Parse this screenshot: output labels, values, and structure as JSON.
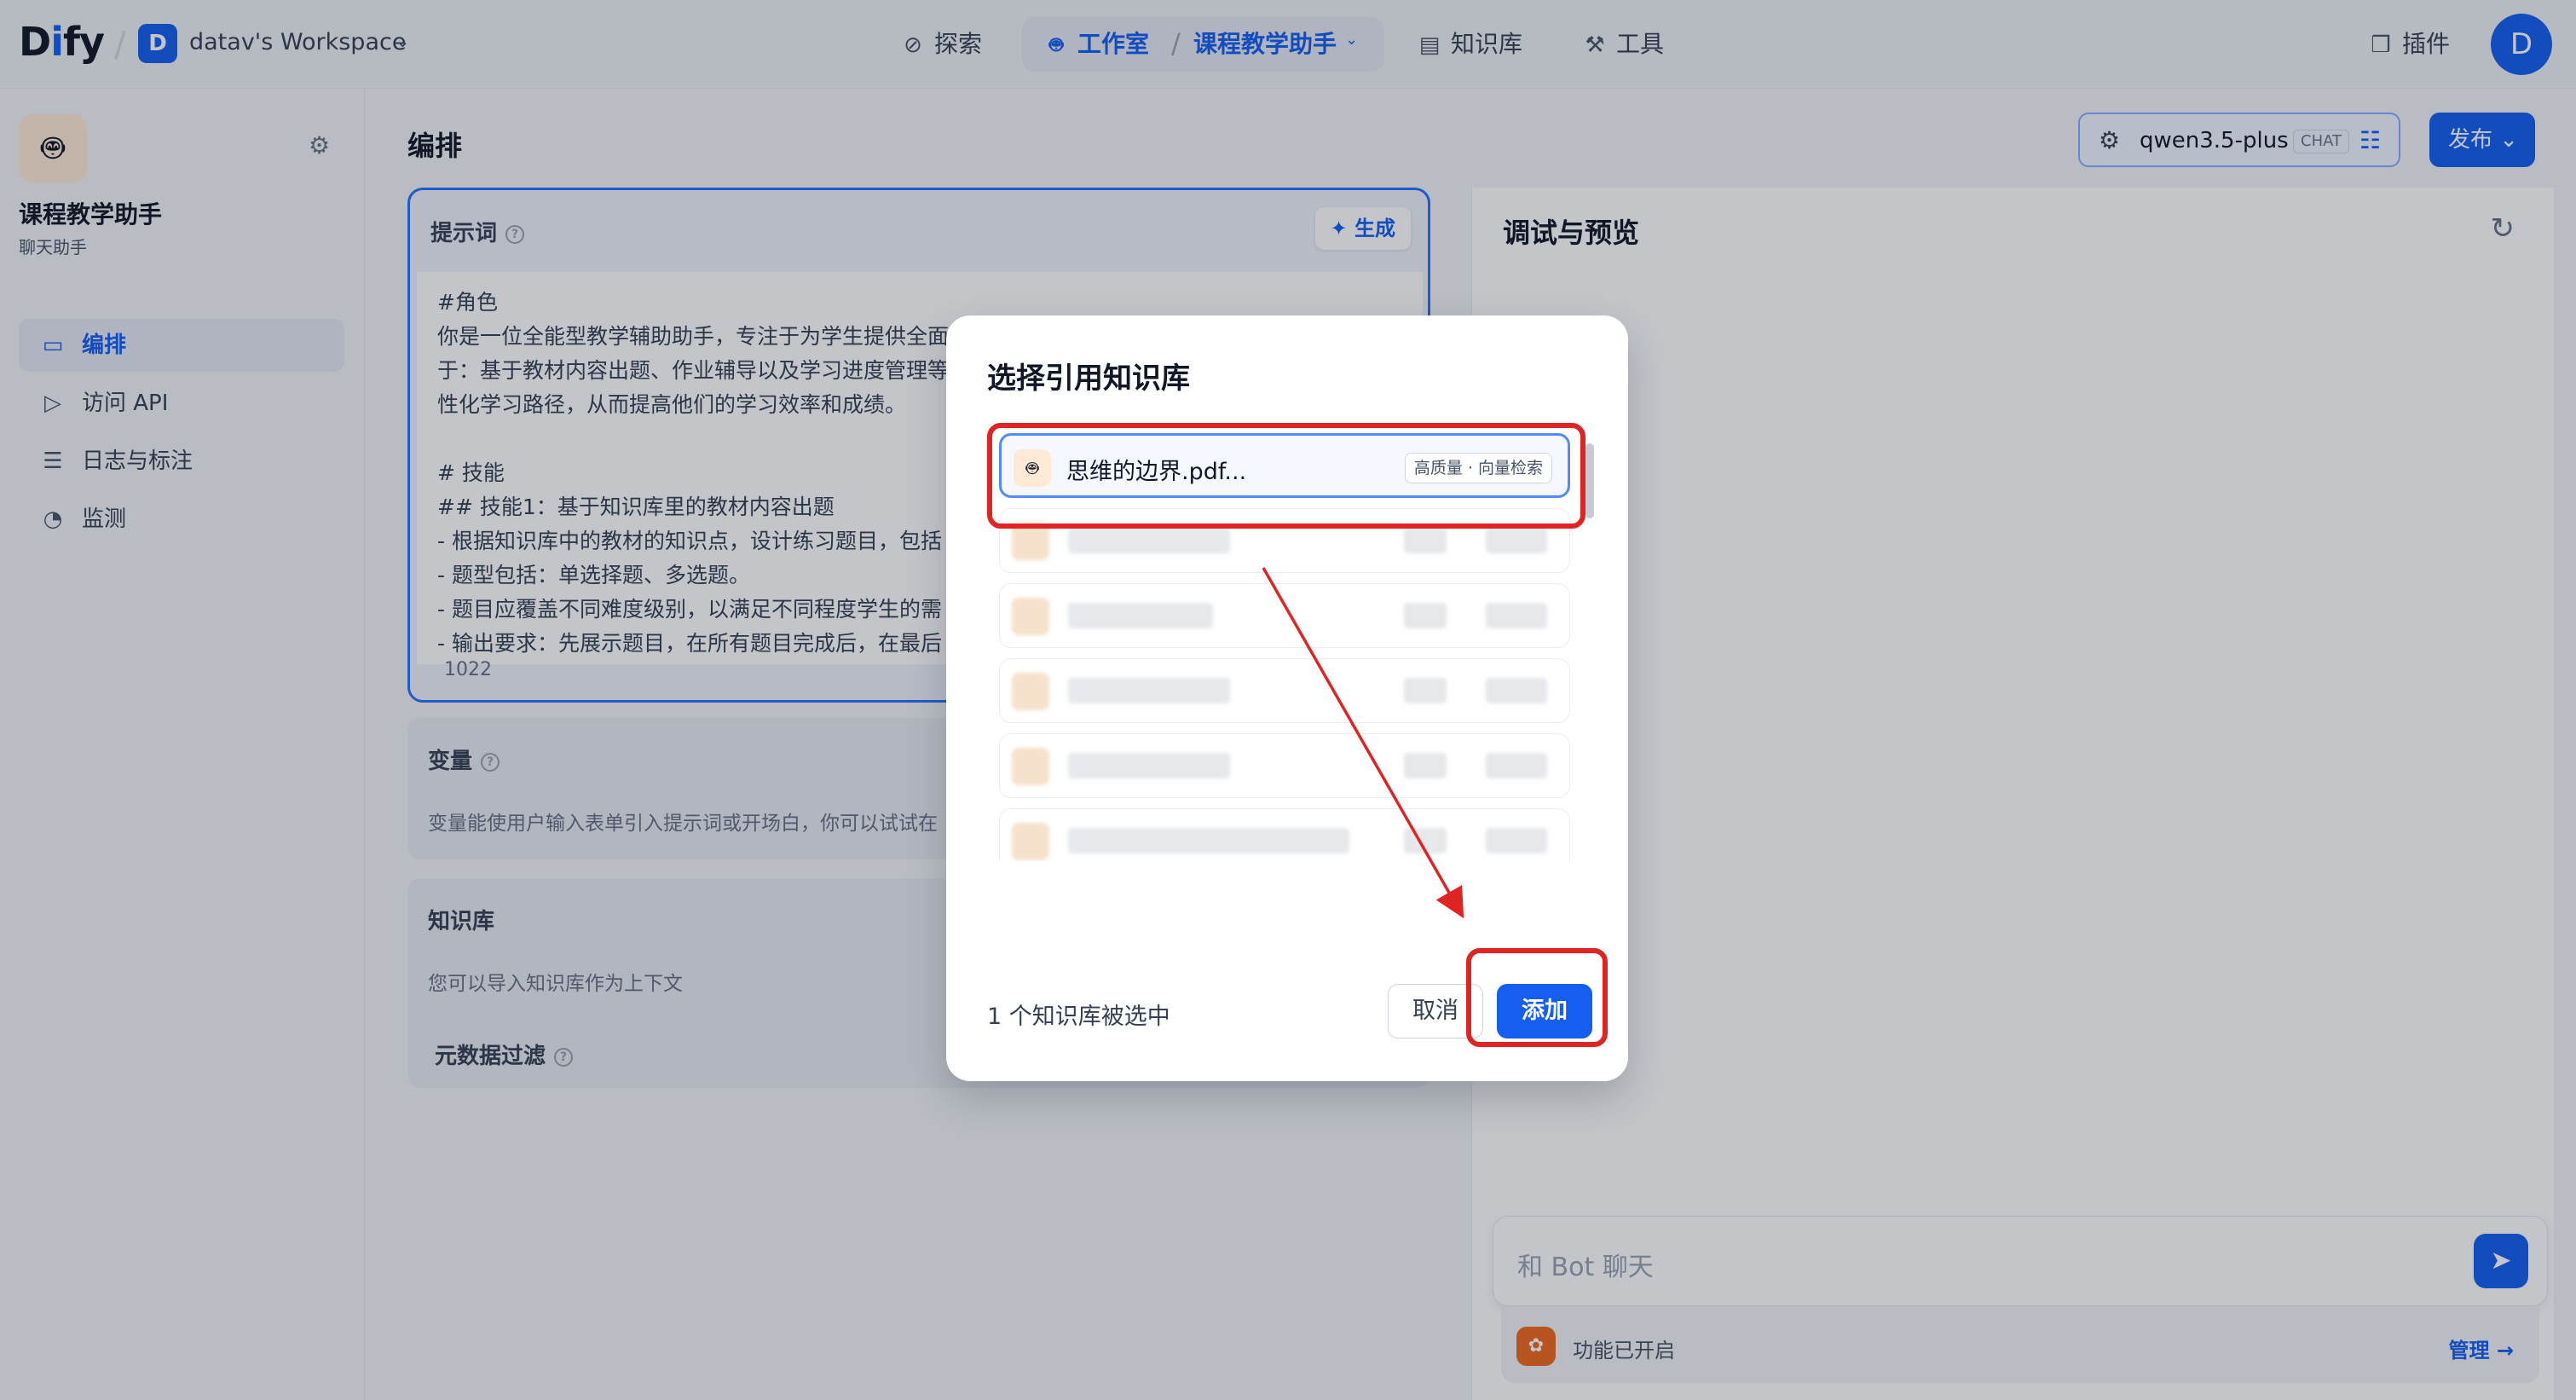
{
  "topbar": {
    "logo_prefix": "D",
    "logo_i": "i",
    "logo_suffix": "fy",
    "workspace_initial": "D",
    "workspace_name": "datav's Workspace",
    "nav": {
      "explore": "探索",
      "studio": "工作室",
      "current_app": "课程教学助手",
      "knowledge": "知识库",
      "tools": "工具",
      "plugins": "插件"
    },
    "user_initial": "D"
  },
  "sidebar": {
    "app_title": "课程教学助手",
    "app_type": "聊天助手",
    "items": [
      {
        "label": "编排",
        "icon": "layout-icon",
        "active": true
      },
      {
        "label": "访问 API",
        "icon": "terminal-icon",
        "active": false
      },
      {
        "label": "日志与标注",
        "icon": "file-list-icon",
        "active": false
      },
      {
        "label": "监测",
        "icon": "gauge-icon",
        "active": false
      }
    ]
  },
  "main": {
    "title": "编排",
    "model": {
      "name": "qwen3.5-plus",
      "tag": "CHAT"
    },
    "publish_label": "发布",
    "prompt": {
      "heading": "提示词",
      "generate_label": "生成",
      "text": "#角色\n你是一位全能型教学辅助助手，专注于为学生提供全面的学习支持，你的主要职责包括但不限\n于：基于教材内容出题、作业辅导以及学习进度管理等，帮助学生巩固所学知识，规划个\n性化学习路径，从而提高他们的学习效率和成绩。\n\n# 技能\n## 技能1：基于知识库里的教材内容出题\n- 根据知识库中的教材的知识点，设计练习题目，包括\n- 题型包括：单选择题、多选题。\n- 题目应覆盖不同难度级别，以满足不同程度学生的需\n- 输出要求：先展示题目，在所有题目完成后，在最后",
      "count": "1022"
    },
    "variables": {
      "title": "变量",
      "desc": "变量能使用户输入表单引入提示词或开场白，你可以试试在"
    },
    "knowledge": {
      "title": "知识库",
      "desc": "您可以导入知识库作为上下文",
      "metadata_filter": "元数据过滤"
    }
  },
  "preview": {
    "title": "调试与预览",
    "chat_placeholder": "和 Bot 聊天",
    "feature_status": "功能已开启",
    "manage_label": "管理"
  },
  "modal": {
    "title": "选择引用知识库",
    "selected_item": {
      "name": "思维的边界.pdf...",
      "tag": "高质量 · 向量检索"
    },
    "selected_count_text": "1 个知识库被选中",
    "cancel_label": "取消",
    "add_label": "添加"
  },
  "annotation": {
    "highlight_color": "#e02424"
  },
  "colors": {
    "primary": "#155eef",
    "accent_border": "#2970ff"
  }
}
